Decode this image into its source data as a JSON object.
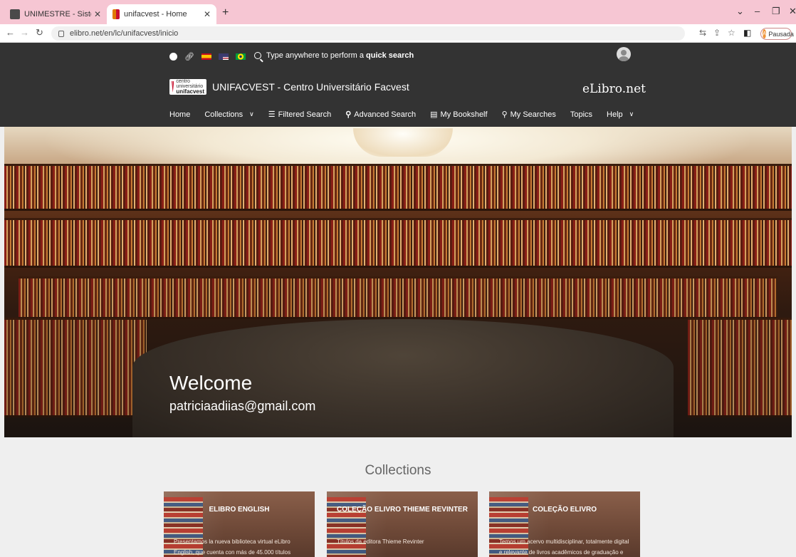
{
  "browser": {
    "tabs": [
      {
        "title": "UNIMESTRE - Sistema de gestão",
        "active": false
      },
      {
        "title": "unifacvest - Home",
        "active": true
      }
    ],
    "url": "elibro.net/en/lc/unifacvest/inicio",
    "profile_initial": "A",
    "profile_label": "Pausada"
  },
  "header": {
    "quick_search_prefix": "Type anywhere to perform a ",
    "quick_search_bold": "quick search",
    "institution": "UNIFACVEST - Centro Universitário Facvest",
    "logo_small": "centro universitário",
    "logo_name": "unifacvest",
    "brand": "eLibro.net"
  },
  "nav": {
    "home": "Home",
    "collections": "Collections",
    "filtered_search": "Filtered Search",
    "advanced_search": "Advanced Search",
    "my_bookshelf": "My Bookshelf",
    "my_searches": "My Searches",
    "topics": "Topics",
    "help": "Help"
  },
  "hero": {
    "welcome": "Welcome",
    "email": "patriciaadiias@gmail.com"
  },
  "collections": {
    "title": "Collections",
    "cards": [
      {
        "title": "ELIBRO ENGLISH",
        "desc": "Presentamos la nueva biblioteca virtual eLibro English, que cuenta con más de 45.000 títulos"
      },
      {
        "title": "COLEÇÃO ELIVRO THIEME REVINTER",
        "desc": "Títulos da editora Thieme Revinter"
      },
      {
        "title": "COLEÇÃO ELIVRO",
        "desc": "Temos um acervo multidisciplinar, totalmente digital e relevante de livros acadêmicos de graduação e pós-"
      }
    ]
  },
  "colors": {
    "tabbar": "#f6c6d3",
    "header_bg": "#333333",
    "page_bg": "#efefef"
  }
}
